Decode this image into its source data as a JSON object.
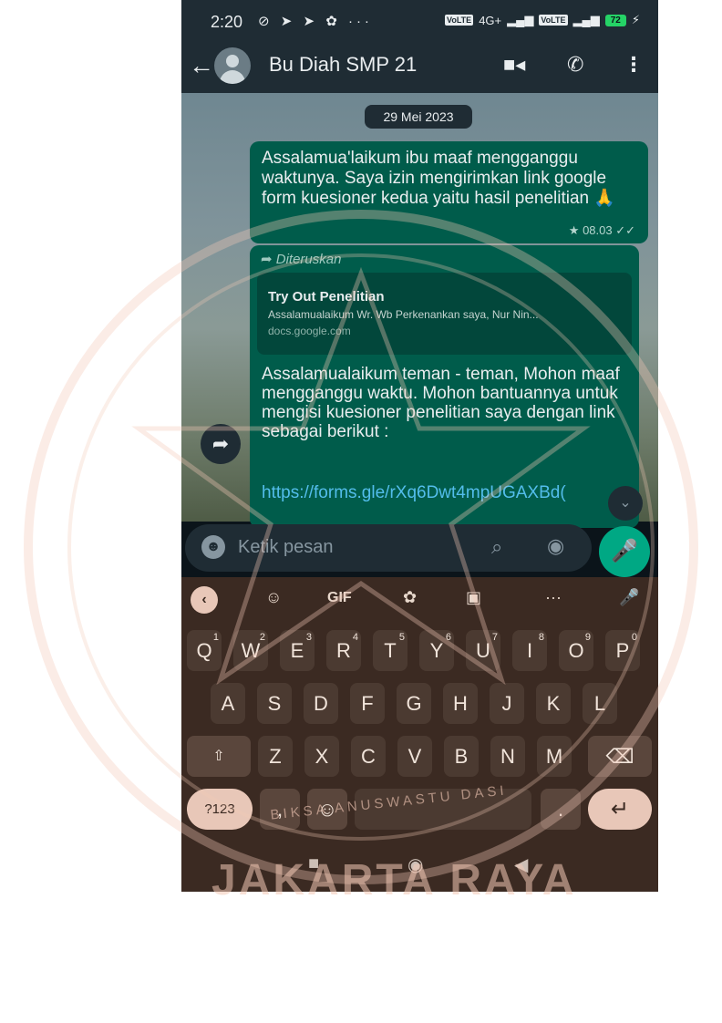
{
  "status_bar": {
    "time": "2:20",
    "icons": "⊘ ➤ ➤ ✿ ···",
    "lte1": "VoLTE",
    "net": "4G+",
    "lte2": "VoLTE",
    "battery": "72"
  },
  "header": {
    "contact_name": "Bu Diah SMP 21"
  },
  "chat": {
    "date_chip": "29 Mei 2023",
    "messages": [
      {
        "text": "Assalamua'laikum ibu maaf mengganggu waktunya. Saya izin mengirimkan link google form kuesioner kedua yaitu hasil penelitian 🙏",
        "time": "★ 08.03 ✓✓"
      },
      {
        "forwarded_label": "Diteruskan",
        "preview_title": "Try Out Penelitian",
        "preview_desc": "Assalamualaikum Wr. Wb Perkenankan saya, Nur Nin...",
        "preview_url": "docs.google.com",
        "text": "Assalamualaikum teman - teman, Mohon maaf mengganggu waktu. Mohon bantuannya untuk mengisi kuesioner penelitian saya dengan link sebagai berikut :",
        "link": "https://forms.gle/rXq6Dwt4mpUGAXBd("
      }
    ]
  },
  "input": {
    "placeholder": "Ketik pesan"
  },
  "keyboard": {
    "gif_label": "GIF",
    "row1": [
      "Q",
      "W",
      "E",
      "R",
      "T",
      "Y",
      "U",
      "I",
      "O",
      "P"
    ],
    "row1_hints": [
      "1",
      "2",
      "3",
      "4",
      "5",
      "6",
      "7",
      "8",
      "9",
      "0"
    ],
    "row2": [
      "A",
      "S",
      "D",
      "F",
      "G",
      "H",
      "J",
      "K",
      "L"
    ],
    "row3": [
      "Z",
      "X",
      "C",
      "V",
      "B",
      "N",
      "M"
    ],
    "sym_key": "?123",
    "comma": ",",
    "period": "."
  },
  "watermark": {
    "bottom_text": "JAKARTA RAYA",
    "seal_text": "BIKSA ANUSWASTU DASI"
  },
  "colors": {
    "header_bg": "#1f2c34",
    "bubble_out": "#005c4b",
    "accent": "#00a884",
    "watermark": "#f3c9b6"
  }
}
